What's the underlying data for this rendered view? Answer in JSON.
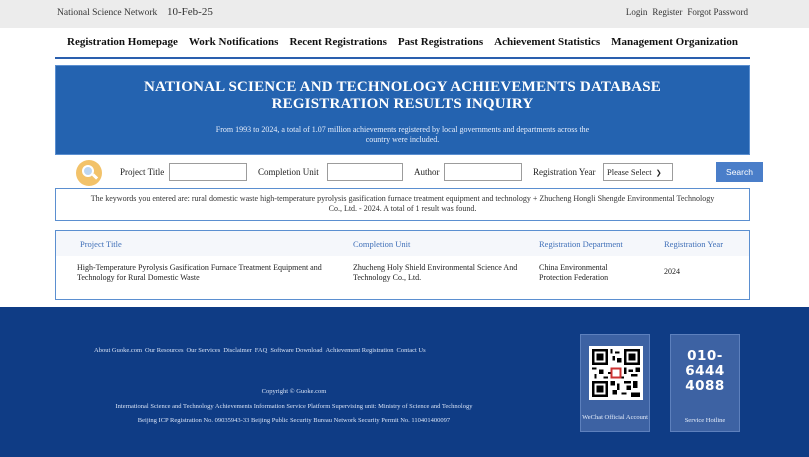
{
  "topbar": {
    "site_name": "National Science Network",
    "date": "10-Feb-25",
    "links": [
      "Login",
      "Register",
      "Forgot Password"
    ]
  },
  "nav": {
    "items": [
      "Registration Homepage",
      "Work Notifications",
      "Recent Registrations",
      "Past Registrations",
      "Achievement Statistics",
      "Management Organization"
    ]
  },
  "banner": {
    "title_line1": "NATIONAL SCIENCE AND TECHNOLOGY ACHIEVEMENTS DATABASE",
    "title_line2": "REGISTRATION RESULTS INQUIRY",
    "subtitle": "From 1993 to 2024, a total of 1.07 million achievements registered by local governments and departments across the country were included."
  },
  "search": {
    "project_title_label": "Project Title",
    "completion_unit_label": "Completion Unit",
    "author_label": "Author",
    "registration_year_label": "Registration Year",
    "year_select_value": "Please Select",
    "search_button": "Search"
  },
  "result_notice": "The keywords you entered are: rural domestic waste high-temperature pyrolysis gasification furnace treatment equipment and technology + Zhucheng Hongli Shengde Environmental Technology Co., Ltd. - 2024. A total of 1 result was found.",
  "table": {
    "headers": [
      "Project Title",
      "Completion Unit",
      "Registration Department",
      "Registration Year"
    ],
    "rows": [
      {
        "project_title": "High-Temperature Pyrolysis Gasification Furnace Treatment Equipment and Technology for Rural Domestic Waste",
        "completion_unit": "Zhucheng Holy Shield Environmental Science And Technology Co., Ltd.",
        "registration_department": "China Environmental Protection Federation",
        "registration_year": "2024"
      }
    ]
  },
  "footer": {
    "links": [
      "About Guoke.com",
      "Our Resources",
      "Our Services",
      "Disclaimer",
      "FAQ",
      "Software Download",
      "Achievement Registration",
      "Contact Us"
    ],
    "copyright": "Copyright © Guoke.com",
    "platform_line": "International Science and Technology Achievements Information Service Platform   Supervising unit: Ministry of Science and Technology",
    "icp_line": "Beijing ICP Registration No. 09035943-33   Beijing Public Security Bureau Network Security Permit No. 110401400097",
    "wechat_label": "WeChat Official Account",
    "hotline_line1": "010-",
    "hotline_line2": "6444",
    "hotline_line3": "4088",
    "hotline_label": "Service Hotline"
  },
  "colors": {
    "banner_blue": "#2463b0",
    "footer_navy": "#0f3c85",
    "link_blue": "#3f6fb8",
    "button_blue": "#4a7ec9"
  }
}
